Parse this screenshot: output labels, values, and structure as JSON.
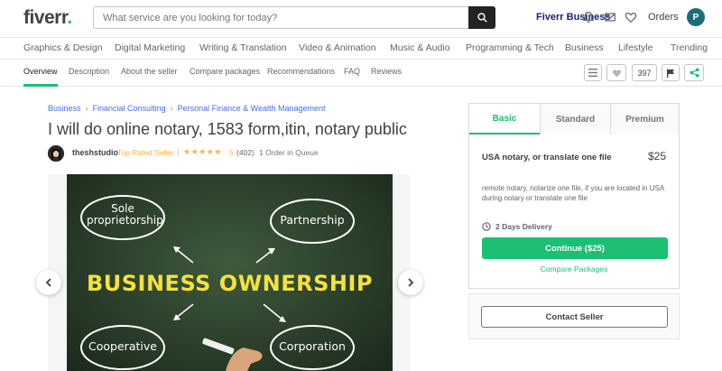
{
  "header": {
    "logo": "fiverr",
    "logo_dot": ".",
    "search_placeholder": "What service are you looking for today?",
    "business_link": "Fiverr Business",
    "orders_link": "Orders",
    "avatar_initial": "P"
  },
  "categories": [
    "Graphics & Design",
    "Digital Marketing",
    "Writing & Translation",
    "Video & Animation",
    "Music & Audio",
    "Programming & Tech",
    "Business",
    "Lifestyle",
    "Trending"
  ],
  "gig_nav": {
    "items": [
      "Overview",
      "Description",
      "About the seller",
      "Compare packages",
      "Recommendations",
      "FAQ",
      "Reviews"
    ],
    "like_count": "397"
  },
  "breadcrumb": [
    "Business",
    "Financial Consulting",
    "Personal Finance & Wealth Management"
  ],
  "gig": {
    "title": "I will do online notary, 1583 form,itin, notary public",
    "seller_name": "theshstudio",
    "seller_level": "Top Rated Seller",
    "rating": "5",
    "review_count": "(402)",
    "queue": "1 Order in Queue"
  },
  "gallery_image": {
    "center_text": "BUSINESS OWNERSHIP",
    "bubbles": [
      "Sole proprietorship",
      "Partnership",
      "Cooperative",
      "Corporation"
    ]
  },
  "package": {
    "tabs": [
      "Basic",
      "Standard",
      "Premium"
    ],
    "name": "USA notary, or translate one file",
    "price": "$25",
    "description": "remote notary, notarize one file, if you are located in USA during notary or translate one file",
    "delivery": "2 Days Delivery",
    "continue_label": "Continue ($25)",
    "compare_label": "Compare Packages"
  },
  "contact_label": "Contact Seller",
  "colors": {
    "brand_green": "#1dbf73",
    "link_blue": "#446ee7",
    "star_orange": "#ffb33e",
    "business_navy": "#1a1f71"
  }
}
